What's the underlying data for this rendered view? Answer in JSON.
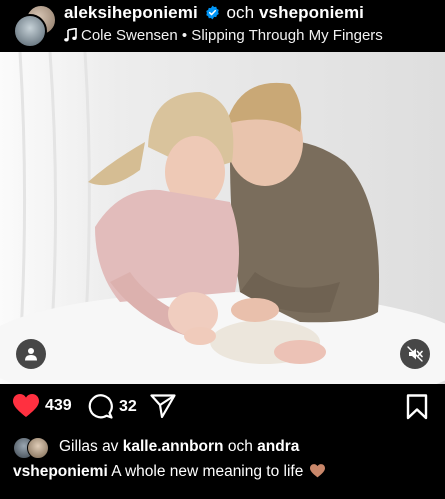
{
  "header": {
    "primary_user": "aleksiheponiemi",
    "joiner": "och",
    "collab_user": "vsheponiemi",
    "music": "Cole Swensen • Slipping Through My Fingers"
  },
  "actions": {
    "like_count": "439",
    "comment_count": "32"
  },
  "likes": {
    "prefix": "Gillas av",
    "user1": "kalle.annborn",
    "joiner": "och",
    "user2": "andra"
  },
  "caption": {
    "user": "vsheponiemi",
    "text": "A whole new meaning to life"
  },
  "colors": {
    "like_red": "#ff3040",
    "verified_blue": "#0095f6"
  }
}
